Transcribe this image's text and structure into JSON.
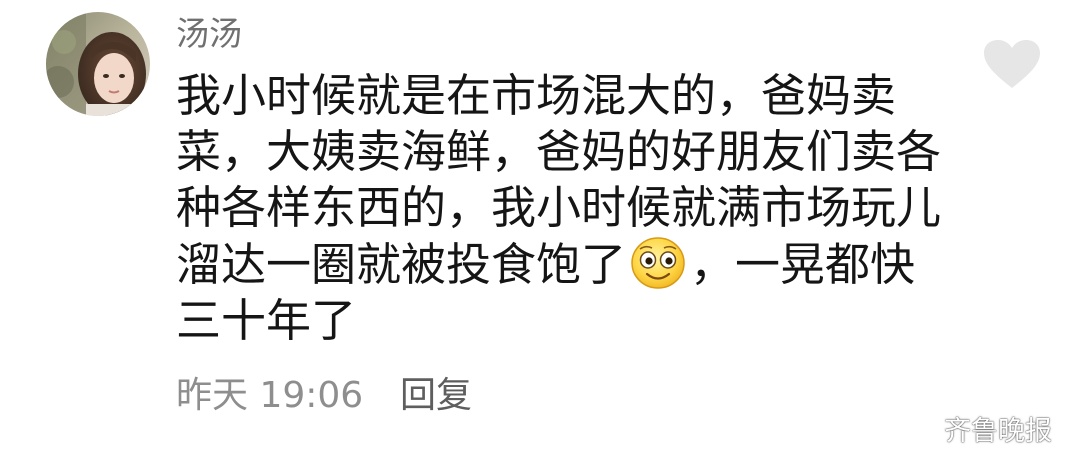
{
  "comment": {
    "username": "汤汤",
    "avatar_icon": "user-avatar-photo",
    "lines": [
      "我小时候就是在市场混大的，爸妈卖",
      "菜，大姨卖海鲜，爸妈的好朋友们卖各",
      "种各样东西的，我小时候就满市场玩儿",
      "溜达一圈就被投食饱了",
      "，一晃都快",
      "三十年了"
    ],
    "inline_emoji_icon": "smiley-face-emoji",
    "timestamp": "昨天 19:06",
    "reply_label": "回复",
    "like_icon": "heart-icon",
    "like_icon_color": "#e6e6e6"
  },
  "watermark": {
    "text": "齐鲁晚报",
    "icon": "wechat-icon"
  }
}
